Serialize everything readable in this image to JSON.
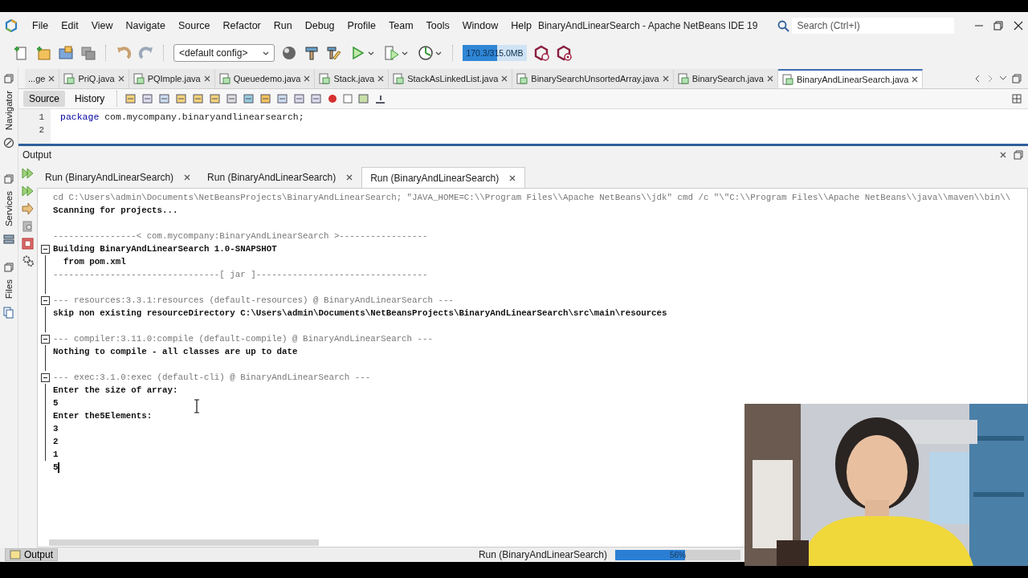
{
  "window": {
    "title": "BinaryAndLinearSearch - Apache NetBeans IDE 19",
    "search": {
      "placeholder": "Search (Ctrl+I)"
    }
  },
  "menu": [
    "File",
    "Edit",
    "View",
    "Navigate",
    "Source",
    "Refactor",
    "Run",
    "Debug",
    "Profile",
    "Team",
    "Tools",
    "Window",
    "Help"
  ],
  "toolbar": {
    "config": "<default config>",
    "memory": {
      "label": "170.3/315.0MB",
      "level": 0.54
    }
  },
  "side_panels": [
    "Navigator",
    "Services",
    "Files"
  ],
  "editor": {
    "tabs": [
      {
        "label": "...ge",
        "selected": false
      },
      {
        "label": "PriQ.java",
        "selected": false
      },
      {
        "label": "PQImple.java",
        "selected": false
      },
      {
        "label": "Queuedemo.java",
        "selected": false
      },
      {
        "label": "Stack.java",
        "selected": false
      },
      {
        "label": "StackAsLinkedList.java",
        "selected": false
      },
      {
        "label": "BinarySearchUnsortedArray.java",
        "selected": false
      },
      {
        "label": "BinarySearch.java",
        "selected": false
      },
      {
        "label": "BinaryAndLinearSearch.java",
        "selected": true
      }
    ],
    "views": [
      {
        "label": "Source",
        "selected": true
      },
      {
        "label": "History",
        "selected": false
      }
    ],
    "lines": [
      {
        "number": "1",
        "keyword": "package",
        "code": "com.mycompany.binaryandlinearsearch;"
      },
      {
        "number": "2"
      }
    ]
  },
  "output": {
    "title": "Output",
    "tabs": [
      {
        "label": "Run (BinaryAndLinearSearch)",
        "selected": false
      },
      {
        "label": "Run (BinaryAndLinearSearch)",
        "selected": false
      },
      {
        "label": "Run (BinaryAndLinearSearch)",
        "selected": true
      }
    ],
    "lines": [
      {
        "kind": "command",
        "text": "cd C:\\Users\\admin\\Documents\\NetBeansProjects\\BinaryAndLinearSearch; \"JAVA_HOME=C:\\\\Program Files\\\\Apache NetBeans\\\\jdk\" cmd /c \"\\\"C:\\\\Program Files\\\\Apache NetBeans\\\\java\\\\maven\\\\bin\\\\",
        "fold": false,
        "spaced": false
      },
      {
        "kind": "log",
        "text": "Scanning for projects...",
        "fold": false,
        "spaced": false
      },
      {
        "kind": "command",
        "text": "----------------< com.mycompany:BinaryAndLinearSearch >-----------------",
        "fold": false,
        "spaced": true
      },
      {
        "kind": "log",
        "text": "Building BinaryAndLinearSearch 1.0-SNAPSHOT",
        "fold": true,
        "spaced": false
      },
      {
        "kind": "log",
        "text": "  from pom.xml",
        "fold": false,
        "spaced": false
      },
      {
        "kind": "command",
        "text": "--------------------------------[ jar ]---------------------------------",
        "fold": false,
        "spaced": false
      },
      {
        "kind": "command",
        "text": "--- resources:3.3.1:resources (default-resources) @ BinaryAndLinearSearch ---",
        "fold": true,
        "spaced": true
      },
      {
        "kind": "log",
        "text": "skip non existing resourceDirectory C:\\Users\\admin\\Documents\\NetBeansProjects\\BinaryAndLinearSearch\\src\\main\\resources",
        "fold": false,
        "spaced": false
      },
      {
        "kind": "command",
        "text": "--- compiler:3.11.0:compile (default-compile) @ BinaryAndLinearSearch ---",
        "fold": true,
        "spaced": true
      },
      {
        "kind": "log",
        "text": "Nothing to compile - all classes are up to date",
        "fold": false,
        "spaced": false
      },
      {
        "kind": "command",
        "text": "--- exec:3.1.0:exec (default-cli) @ BinaryAndLinearSearch ---",
        "fold": true,
        "spaced": true
      },
      {
        "kind": "log",
        "text": "Enter the size of array:",
        "fold": false,
        "spaced": false
      },
      {
        "kind": "log",
        "text": "5",
        "fold": false,
        "spaced": false
      },
      {
        "kind": "log",
        "text": "Enter the5Elements:",
        "fold": false,
        "spaced": false
      },
      {
        "kind": "log",
        "text": "3",
        "fold": false,
        "spaced": false
      },
      {
        "kind": "log",
        "text": "2",
        "fold": false,
        "spaced": false
      },
      {
        "kind": "log",
        "text": "1",
        "fold": false,
        "spaced": false
      },
      {
        "kind": "input",
        "text": "5",
        "fold": false,
        "spaced": false
      }
    ]
  },
  "status_bar": {
    "output_button": "Output",
    "task": "Run (BinaryAndLinearSearch)",
    "progress": {
      "level": 0.56,
      "label": "56%"
    }
  }
}
